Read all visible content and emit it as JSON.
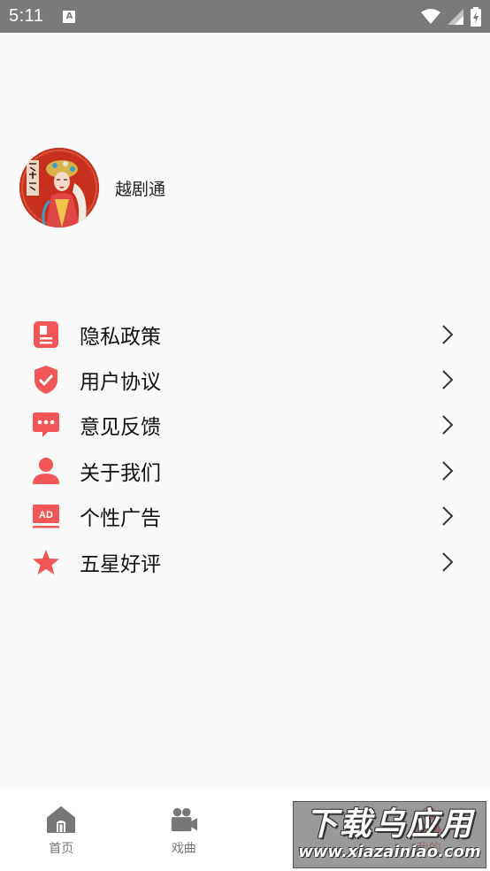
{
  "status_bar": {
    "time": "5:11",
    "indicator": "A"
  },
  "profile": {
    "name": "越剧通"
  },
  "menu": [
    {
      "label": "隐私政策",
      "icon": "document-icon"
    },
    {
      "label": "用户协议",
      "icon": "shield-check-icon"
    },
    {
      "label": "意见反馈",
      "icon": "chat-bubble-icon"
    },
    {
      "label": "关于我们",
      "icon": "user-icon"
    },
    {
      "label": "个性广告",
      "icon": "ad-icon"
    },
    {
      "label": "五星好评",
      "icon": "star-icon"
    }
  ],
  "bottom_nav": [
    {
      "label": "首页",
      "icon": "home-icon",
      "active": false
    },
    {
      "label": "戏曲",
      "icon": "video-camera-icon",
      "active": false
    },
    {
      "label": "",
      "icon": "obscured-icon",
      "active": false
    },
    {
      "label": "我的",
      "icon": "person-icon",
      "active": true
    }
  ],
  "watermark": {
    "line1": "下载乌应用",
    "line2": "www.xiazainiao.com"
  },
  "colors": {
    "accent": "#ef4b4b",
    "status_bar": "#7a7a7a",
    "background": "#fafafa"
  }
}
